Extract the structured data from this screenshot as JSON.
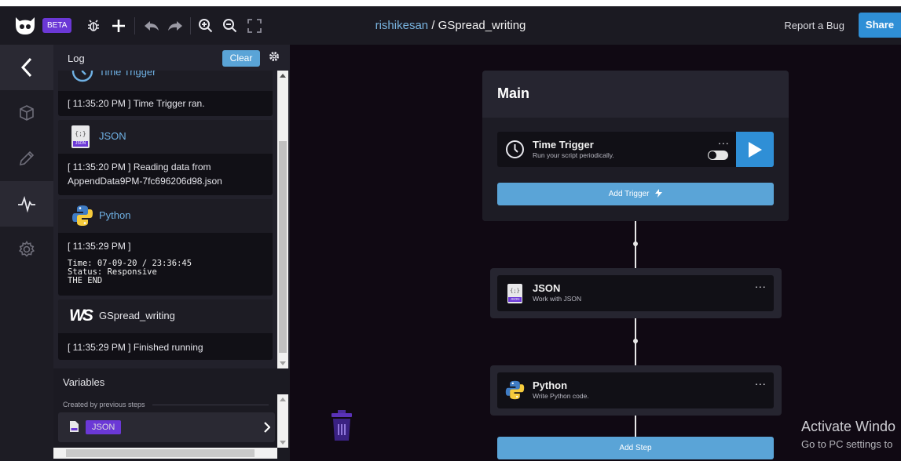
{
  "app": {
    "beta": "BETA",
    "owner": "rishikesan",
    "separator": "/",
    "workflow": "GSpread_writing",
    "report_bug": "Report a Bug",
    "share": "Share"
  },
  "toolbar": {
    "icons": [
      "bug-icon",
      "plus-icon",
      "undo-icon",
      "redo-icon",
      "zoom-in-icon",
      "zoom-out-icon",
      "fullscreen-icon"
    ]
  },
  "rail": {
    "items": [
      "back-icon",
      "cube-icon",
      "pencil-icon",
      "activity-icon",
      "gear-icon"
    ]
  },
  "log": {
    "label": "Log",
    "clear": "Clear",
    "entries": [
      {
        "name": "Time Trigger",
        "lines": [
          "[ 11:35:20 PM ] Time Trigger ran."
        ],
        "output": ""
      },
      {
        "name": "JSON",
        "lines": [
          "[ 11:35:20 PM ] Reading data from",
          "AppendData9PM-7fc696206d98.json"
        ],
        "output": ""
      },
      {
        "name": "Python",
        "lines": [
          "[ 11:35:29 PM ]"
        ],
        "output": "Time: 07-09-20 / 23:36:45\nStatus: Responsive\nTHE END"
      },
      {
        "name": "GSpread_writing",
        "lines": [
          "[ 11:35:29 PM ] Finished running"
        ],
        "output": ""
      }
    ]
  },
  "variables": {
    "label": "Variables",
    "subtitle": "Created by previous steps",
    "item": "JSON"
  },
  "canvas": {
    "main_title": "Main",
    "trigger": {
      "name": "Time Trigger",
      "desc": "Run your script periodically."
    },
    "add_trigger": "Add Trigger",
    "steps": [
      {
        "name": "JSON",
        "desc": "Work with JSON"
      },
      {
        "name": "Python",
        "desc": "Write Python code."
      }
    ],
    "add_step": "Add Step",
    "menu_glyph": "...",
    "json_icon_text": "{;}",
    "json_icon_caption": "JSON",
    "ws_logo": "WS"
  },
  "watermark": {
    "line1": "Activate Windo",
    "line2": "Go to PC settings to"
  },
  "colors": {
    "accent_blue": "#5aa4d7",
    "share_blue": "#2f8fd6",
    "beta_purple": "#6b38d6",
    "canvas_bg": "#100913"
  }
}
